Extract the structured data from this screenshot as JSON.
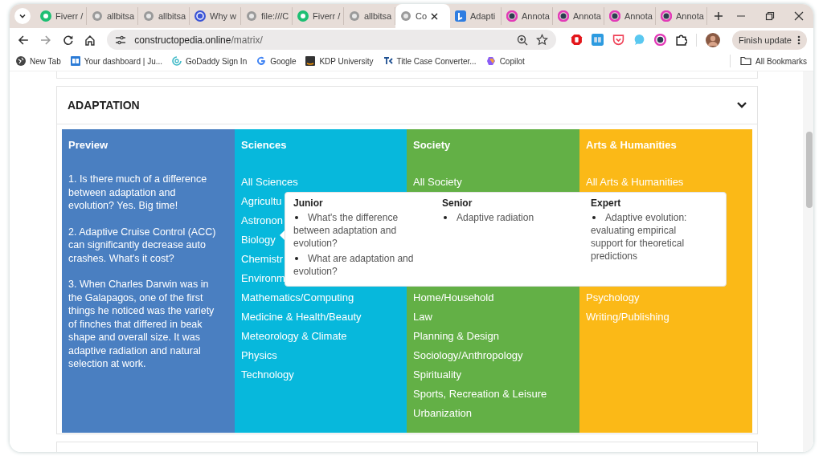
{
  "tabs": [
    {
      "title": "Fiverr /",
      "selected": false
    },
    {
      "title": "allbitsa",
      "selected": false
    },
    {
      "title": "allbitsa",
      "selected": false
    },
    {
      "title": "Why w",
      "selected": false
    },
    {
      "title": "file:///C",
      "selected": false
    },
    {
      "title": "Fiverr /",
      "selected": false
    },
    {
      "title": "allbitsa",
      "selected": false
    },
    {
      "title": "Co",
      "selected": true
    },
    {
      "title": "Adapti",
      "selected": false
    },
    {
      "title": "Annota",
      "selected": false
    },
    {
      "title": "Annota",
      "selected": false
    },
    {
      "title": "Annota",
      "selected": false
    },
    {
      "title": "Annota",
      "selected": false
    }
  ],
  "address": {
    "host": "constructopedia.online",
    "path": "/matrix/"
  },
  "update_button": "Finish update",
  "bookmarks": [
    "New Tab",
    "Your dashboard | Ju...",
    "GoDaddy Sign In",
    "Google",
    "KDP University",
    "Title Case Converter...",
    "Copilot"
  ],
  "all_bookmarks": "All Bookmarks",
  "section": {
    "title": "ADAPTATION",
    "expanded": true
  },
  "preview": {
    "title": "Preview",
    "color": "#4a7fc1",
    "paragraphs": [
      "1. Is there much of a difference between adaptation and evolution? Yes. Big time!",
      "2. Adaptive Cruise Control (ACC) can significantly decrease auto crashes. What's it cost?",
      "3. When Charles Darwin was in the Galapagos, one of the first things he noticed was the variety of finches that differed in beak shape and overall size. It was adaptive radiation and natural selection at work."
    ]
  },
  "columns": [
    {
      "title": "Sciences",
      "color": "#07b8dc",
      "items": [
        "All Sciences",
        "Agricultu",
        "Astronon",
        "Biology",
        "Chemistr",
        "Environm",
        "Mathematics/Computing",
        "Medicine & Health/Beauty",
        "Meteorology & Climate",
        "Physics",
        "Technology"
      ]
    },
    {
      "title": "Society",
      "color": "#63b046",
      "top_items": [
        "All Society"
      ],
      "items": [
        "Home/Household",
        "Law",
        "Planning & Design",
        "Sociology/Anthropology",
        "Spirituality",
        "Sports, Recreation & Leisure",
        "Urbanization"
      ]
    },
    {
      "title": "Arts & Humanities",
      "color": "#fbb917",
      "top_items": [
        "All Arts & Humanities"
      ],
      "items": [
        "Psychology",
        "Writing/Publishing"
      ]
    }
  ],
  "popup": {
    "levels": [
      {
        "title": "Junior",
        "points": [
          "What's the difference between adaptation and evolution?",
          "What are adaptation and evolution?"
        ]
      },
      {
        "title": "Senior",
        "points": [
          "Adaptive radiation"
        ]
      },
      {
        "title": "Expert",
        "points": [
          "Adaptive evolution: evaluating empirical support for theoretical predictions"
        ]
      }
    ]
  }
}
